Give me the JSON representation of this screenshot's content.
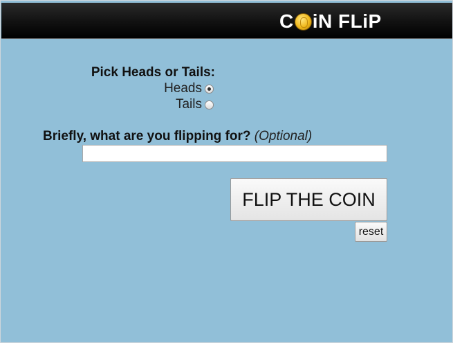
{
  "header": {
    "logo_part1": "C",
    "logo_part2": "iN FLiP",
    "coin_icon": "gold-coin-icon",
    "background_color": "#111111",
    "text_color": "#ffffff"
  },
  "form": {
    "pick_label": "Pick Heads or Tails:",
    "options": [
      {
        "label": "Heads",
        "selected": true
      },
      {
        "label": "Tails",
        "selected": false
      }
    ],
    "reason_label": "Briefly, what are you flipping for?",
    "reason_optional": "(Optional)",
    "reason_value": "",
    "flip_button_label": "FLIP THE COIN",
    "reset_button_label": "reset"
  },
  "colors": {
    "page_background": "#91bfd8",
    "header_background": "#000000"
  }
}
